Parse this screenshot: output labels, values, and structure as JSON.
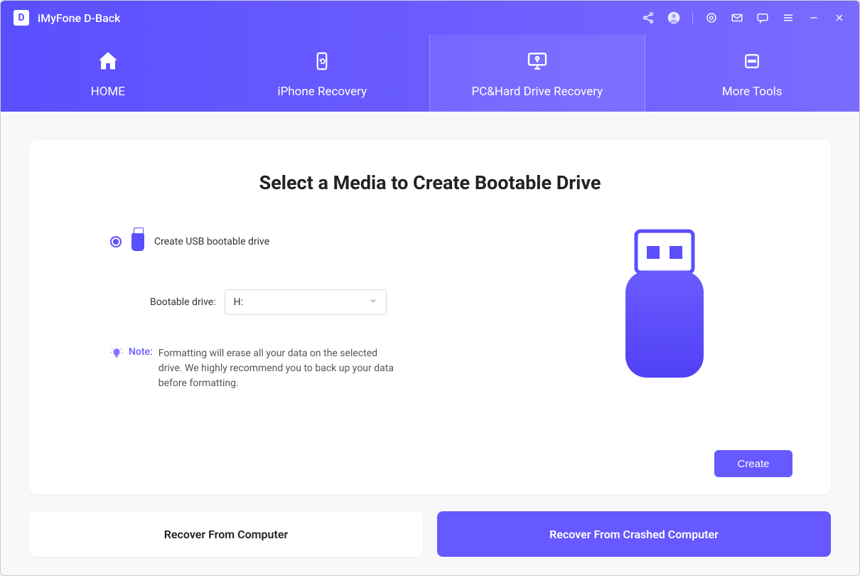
{
  "app": {
    "logo_letter": "D",
    "title": "iMyFone D-Back"
  },
  "nav": {
    "tabs": [
      {
        "label": "HOME"
      },
      {
        "label": "iPhone Recovery"
      },
      {
        "label": "PC&Hard Drive Recovery"
      },
      {
        "label": "More Tools"
      }
    ]
  },
  "main": {
    "heading": "Select a Media to Create Bootable Drive",
    "option_label": "Create USB bootable drive",
    "field_label": "Bootable drive:",
    "selected_drive": "H:",
    "note_label": "Note:",
    "note_text": "Formatting will erase all your data on the selected drive. We highly recommend you to back up your data before formatting.",
    "create_button": "Create"
  },
  "bottom": {
    "tabs": [
      {
        "label": "Recover From Computer"
      },
      {
        "label": "Recover From Crashed Computer"
      }
    ]
  }
}
